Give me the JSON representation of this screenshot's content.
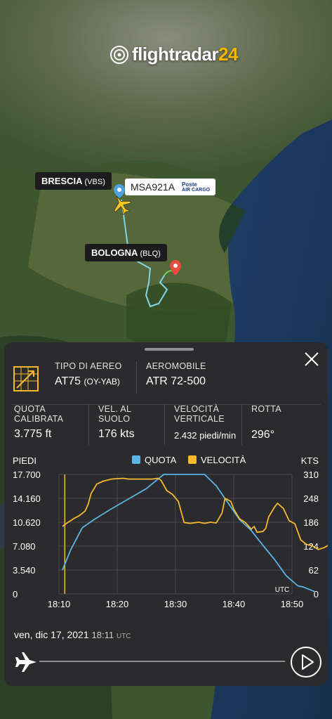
{
  "app": {
    "logo_text": "flightradar",
    "logo_num": "24"
  },
  "map": {
    "origin": {
      "name": "BRESCIA",
      "code": "(VBS)"
    },
    "destination": {
      "name": "BOLOGNA",
      "code": "(BLQ)"
    },
    "flight": {
      "callsign": "MSA921A",
      "airline_top": "Poste",
      "airline_bottom": "AIR CARGO"
    }
  },
  "details": {
    "aircraft_type_label": "TIPO DI AEREO",
    "aircraft_type_value": "AT75",
    "aircraft_reg": "(OY-YAB)",
    "aircraft_label": "AEROMOBILE",
    "aircraft_value": "ATR 72-500",
    "stats": [
      {
        "label1": "QUOTA",
        "label2": "CALIBRATA",
        "value": "3.775 ft"
      },
      {
        "label1": "VEL. AL",
        "label2": "SUOLO",
        "value": "176 kts"
      },
      {
        "label1": "VELOCITÀ",
        "label2": "VERTICALE",
        "value": "2.432 piedi/min"
      },
      {
        "label1": "ROTTA",
        "label2": "",
        "value": "296°"
      }
    ]
  },
  "colors": {
    "altitude": "#5ab4e6",
    "speed": "#f5b82e",
    "panel": "#2b2b2d"
  },
  "chart_data": {
    "type": "line",
    "left_axis_label": "PIEDI",
    "right_axis_label": "KTS",
    "legend": [
      "QUOTA",
      "VELOCITÀ"
    ],
    "legend_placement": "top",
    "x_ticks": [
      "18:10",
      "18:20",
      "18:30",
      "18:40",
      "18:50"
    ],
    "x_range_min": [
      0,
      40
    ],
    "y_left_ticks": [
      "0",
      "3.540",
      "7.080",
      "10.620",
      "14.160",
      "17.700"
    ],
    "y_left_range": [
      0,
      17700
    ],
    "y_right_ticks": [
      "0",
      "62",
      "124",
      "186",
      "248",
      "310"
    ],
    "y_right_range": [
      0,
      310
    ],
    "utc_label": "UTC",
    "cursor_min": 1,
    "series": [
      {
        "name": "QUOTA",
        "axis": "left",
        "points": [
          [
            0.6,
            3540
          ],
          [
            2,
            6500
          ],
          [
            4,
            9800
          ],
          [
            6,
            11000
          ],
          [
            9,
            12600
          ],
          [
            12,
            14100
          ],
          [
            15,
            15600
          ],
          [
            17,
            17000
          ],
          [
            18,
            17700
          ],
          [
            22,
            17700
          ],
          [
            25,
            17700
          ],
          [
            27,
            16000
          ],
          [
            29,
            13500
          ],
          [
            31,
            11000
          ],
          [
            33,
            9400
          ],
          [
            35,
            7200
          ],
          [
            37,
            5100
          ],
          [
            39,
            2700
          ],
          [
            41,
            1200
          ],
          [
            42,
            1000
          ],
          [
            44,
            300
          ]
        ]
      },
      {
        "name": "VELOCITÀ",
        "axis": "right",
        "points": [
          [
            0.6,
            175
          ],
          [
            1.5,
            185
          ],
          [
            2.5,
            195
          ],
          [
            3.5,
            203
          ],
          [
            4.5,
            215
          ],
          [
            5,
            232
          ],
          [
            5.5,
            260
          ],
          [
            6.5,
            285
          ],
          [
            7.5,
            292
          ],
          [
            9,
            298
          ],
          [
            11,
            300
          ],
          [
            12,
            298
          ],
          [
            14,
            298
          ],
          [
            16,
            298
          ],
          [
            17,
            300
          ],
          [
            17.5,
            295
          ],
          [
            18.5,
            268
          ],
          [
            19.5,
            258
          ],
          [
            20.5,
            240
          ],
          [
            21,
            212
          ],
          [
            21.5,
            185
          ],
          [
            22.5,
            183
          ],
          [
            24,
            186
          ],
          [
            25,
            183
          ],
          [
            26,
            186
          ],
          [
            27,
            184
          ],
          [
            28,
            210
          ],
          [
            28.5,
            248
          ],
          [
            29.5,
            240
          ],
          [
            30,
            220
          ],
          [
            31,
            195
          ],
          [
            32,
            185
          ],
          [
            33,
            168
          ],
          [
            33.5,
            175
          ],
          [
            34,
            160
          ],
          [
            35,
            162
          ],
          [
            35.5,
            170
          ],
          [
            36,
            200
          ],
          [
            37,
            225
          ],
          [
            37.5,
            235
          ],
          [
            38.5,
            222
          ],
          [
            39.5,
            190
          ],
          [
            40.5,
            182
          ],
          [
            41.5,
            140
          ],
          [
            42.5,
            128
          ],
          [
            43.5,
            125
          ],
          [
            44.5,
            115
          ],
          [
            45.5,
            120
          ],
          [
            46.5,
            128
          ]
        ]
      }
    ]
  },
  "timeline": {
    "date": "ven, dic 17, 2021",
    "time": "18:11",
    "tz": "UTC"
  }
}
